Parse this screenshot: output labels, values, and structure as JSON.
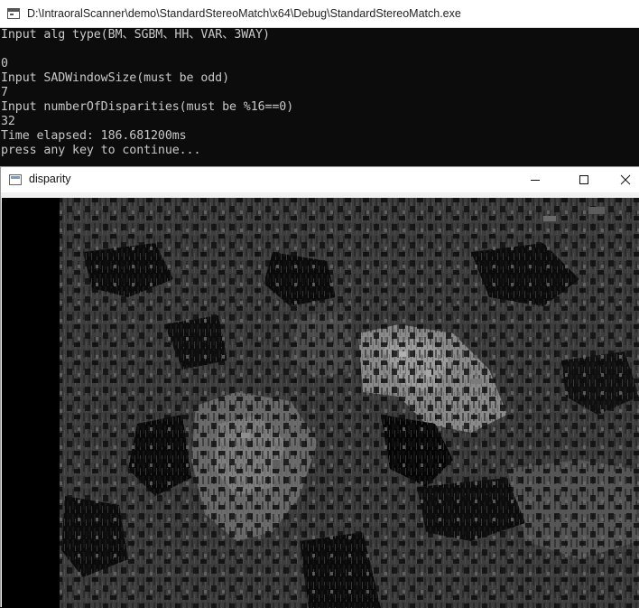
{
  "console": {
    "title": "D:\\IntraoralScanner\\demo\\StandardStereoMatch\\x64\\Debug\\StandardStereoMatch.exe",
    "lines": [
      "Input alg type(BM、SGBM、HH、VAR、3WAY)",
      "",
      "0",
      "Input SADWindowSize(must be odd)",
      "7",
      "Input numberOfDisparities(must be %16==0)",
      "32",
      "Time elapsed: 186.681200ms",
      "press any key to continue..."
    ]
  },
  "disparity_window": {
    "title": "disparity",
    "image_icon": "disparity-map-image"
  },
  "icons": {
    "console": "console-app-icon",
    "window": "window-app-icon",
    "minimize": "minimize-icon",
    "maximize": "maximize-icon",
    "close": "close-icon"
  }
}
